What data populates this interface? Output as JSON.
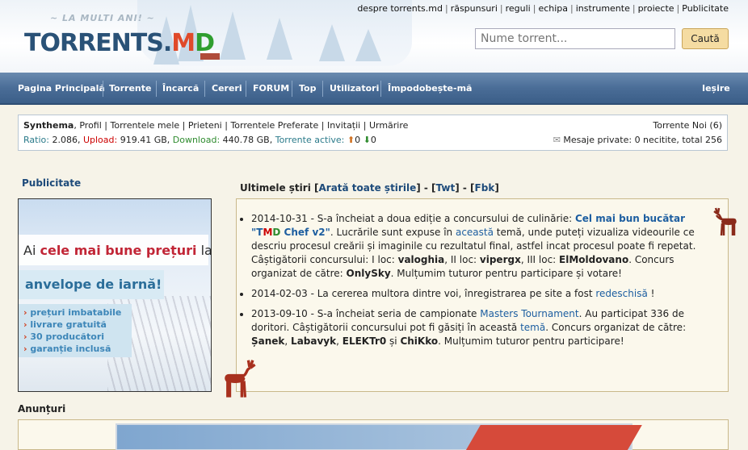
{
  "header": {
    "tagline": "~ LA MULTI ANI! ~",
    "logo_part1": "TORRENTS.",
    "logo_m": "M",
    "logo_d": "D",
    "top_links": [
      "despre torrents.md",
      "răspunsuri",
      "reguli",
      "echipa",
      "instrumente",
      "proiecte",
      "Publicitate"
    ],
    "search_placeholder": "Nume torrent...",
    "search_button": "Caută"
  },
  "nav": {
    "items": [
      "Pagina Principală",
      "Torrente",
      "Încarcă",
      "Cereri",
      "FORUM",
      "Top",
      "Utilizatori",
      "Împodobește-mă"
    ],
    "logout": "Ieșire"
  },
  "user": {
    "name": "Synthema",
    "links": [
      "Profil",
      "Torrentele mele",
      "Prieteni",
      "Torrentele Preferate",
      "Invitații",
      "Urmărire"
    ],
    "ratio_label": "Ratio:",
    "ratio_value": "2.086",
    "upload_label": "Upload:",
    "upload_value": "919.41 GB",
    "download_label": "Download:",
    "download_value": "440.78 GB",
    "active_label": "Torrente active:",
    "active_up": "0",
    "active_down": "0",
    "new_torrents": "Torrente Noi (6)",
    "messages": "Mesaje private: 0 necitite, total 256"
  },
  "ad": {
    "title": "Publicitate",
    "line1_pre": "Ai ",
    "line1_bold": "cele mai bune prețuri",
    "line1_post": " la",
    "line2": "anvelope de iarnă!",
    "bullets": [
      "prețuri imbatabile",
      "livrare gratuită",
      "30 producători",
      "garanție inclusă"
    ]
  },
  "news": {
    "title": "Ultimele știri",
    "show_all": "Arată toate știrile",
    "twt": "Twt",
    "fbk": "Fbk",
    "items": [
      {
        "date": "2014-10-31",
        "text1": " - S-a încheiat a doua ediție a concursului de culinărie: ",
        "link1": "Cel mai bun bucătar",
        "tmd_t": "T",
        "tmd_m": "M",
        "tmd_d": "D",
        "link1b": " Chef v2",
        "text2": ". Lucrările sunt expuse în ",
        "link2": "această",
        "text3": " temă, unde puteți vizualiza videourile ce descriu procesul creării și imaginile cu rezultatul final, astfel incat procesul poate fi repetat. Câștigătorii concursului: I loc: ",
        "w1": "valoghia",
        "text4": ", II loc: ",
        "w2": "vipergx",
        "text5": ", III loc: ",
        "w3": "ElMoldovano",
        "text6": ". Concurs organizat de către: ",
        "w4": "OnlySky",
        "text7": ". Mulțumim tuturor pentru participare și votare!"
      },
      {
        "date": "2014-02-03",
        "text1": " - La cererea multora dintre voi, înregistrarea pe site a fost ",
        "link1": "redeschisă",
        "text2": " !"
      },
      {
        "date": "2013-09-10",
        "text1": " - S-a încheiat seria de campionate ",
        "link1": "Masters Tournament",
        "text2": ". Au participat 336 de doritori. Câștigătorii concursului pot fi găsiți în această ",
        "link2": "temă",
        "text3": ". Concurs organizat de către: ",
        "w1": "Șanek",
        "sep1": ", ",
        "w2": "Labavyk",
        "sep2": ", ",
        "w3": "ELEKTr0",
        "sep3": " și ",
        "w4": "ChiKko",
        "text4": ". Mulțumim tuturor pentru participare!"
      }
    ]
  },
  "announcements": {
    "title": "Anunțuri"
  }
}
